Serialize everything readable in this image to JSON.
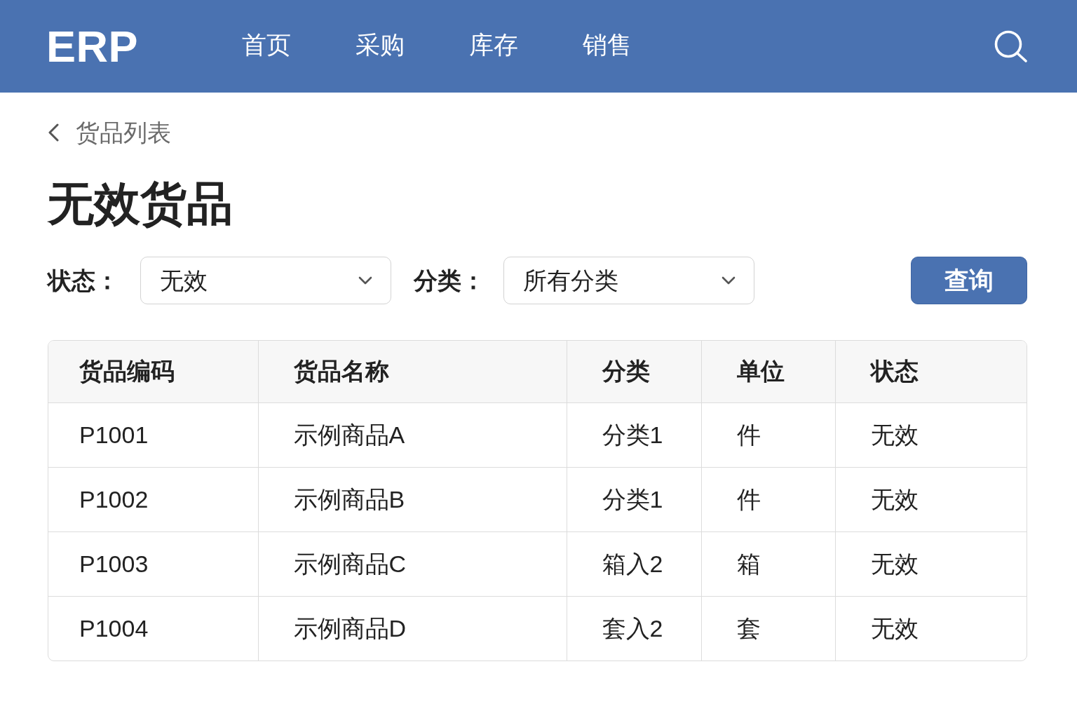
{
  "navbar": {
    "brand": "ERP",
    "items": [
      {
        "label": "首页",
        "selected": false
      },
      {
        "label": "采购",
        "selected": false
      },
      {
        "label": "库存",
        "selected": false
      },
      {
        "label": "销售",
        "selected": false
      }
    ]
  },
  "breadcrumb": {
    "label": "货品列表"
  },
  "title": "无效货品",
  "filters": [
    {
      "label": "状态：",
      "value": "无效"
    },
    {
      "label": "分类：",
      "value": "所有分类"
    }
  ],
  "query_button": "查询",
  "table": {
    "columns": [
      "货品编码",
      "货品名称",
      "分类",
      "单位",
      "状态"
    ],
    "rows": [
      [
        "P1001",
        "示例商品A",
        "分类1",
        "件",
        "无效"
      ],
      [
        "P1002",
        "示例商品B",
        "分类1",
        "件",
        "无效"
      ],
      [
        "P1003",
        "示例商品C",
        "箱入2",
        "箱",
        "无效"
      ],
      [
        "P1004",
        "示例商品D",
        "套入2",
        "套",
        "无效"
      ]
    ]
  }
}
